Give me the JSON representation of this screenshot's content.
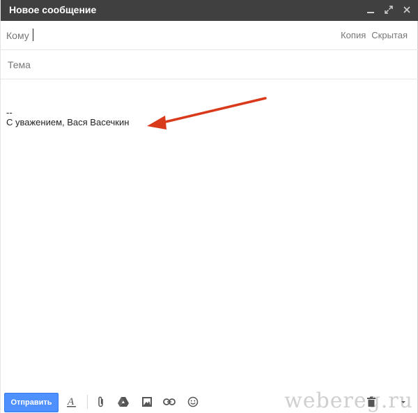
{
  "window": {
    "title": "Новое сообщение"
  },
  "compose": {
    "to_label": "Кому",
    "cc_label": "Копия",
    "bcc_label": "Скрытая",
    "subject_placeholder": "Тема",
    "signature_separator": "--",
    "signature_text": "С уважением, Вася Васечкин"
  },
  "toolbar": {
    "send_label": "Отправить",
    "icons": [
      "formatting-icon",
      "attach-icon",
      "drive-icon",
      "photo-icon",
      "link-icon",
      "emoji-icon",
      "trash-icon",
      "more-options-icon"
    ]
  },
  "watermark": {
    "text": "webereg.ru"
  },
  "colors": {
    "titlebar": "#404040",
    "send_button": "#4d90fe",
    "arrow": "#d93a1c"
  }
}
